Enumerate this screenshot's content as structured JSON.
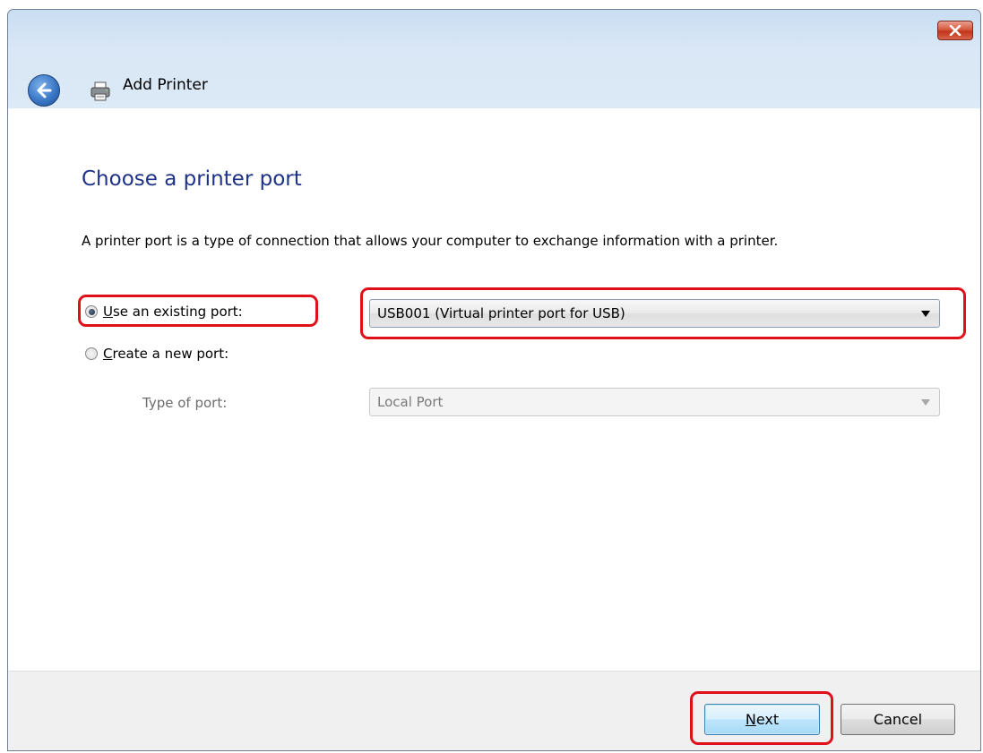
{
  "window": {
    "title": "Add Printer"
  },
  "page": {
    "heading": "Choose a printer port",
    "description": "A printer port is a type of connection that allows your computer to exchange information with a printer."
  },
  "options": {
    "existing_port_label": "Use an existing port:",
    "existing_port_access_key": "U",
    "existing_port_selected": true,
    "existing_port_value": "USB001 (Virtual printer port for USB)",
    "new_port_label": "Create a new port:",
    "new_port_access_key": "C",
    "new_port_selected": false,
    "type_of_port_label": "Type of port:",
    "type_of_port_value": "Local Port"
  },
  "buttons": {
    "next_label": "Next",
    "next_access_key": "N",
    "cancel_label": "Cancel"
  },
  "icons": {
    "close": "close-icon",
    "back": "back-arrow-icon",
    "printer": "printer-icon",
    "dropdown": "chevron-down-icon"
  },
  "colors": {
    "heading": "#1e3287",
    "highlight": "#e0101a",
    "close_button": "#c0341b",
    "back_button": "#3a78c7"
  }
}
